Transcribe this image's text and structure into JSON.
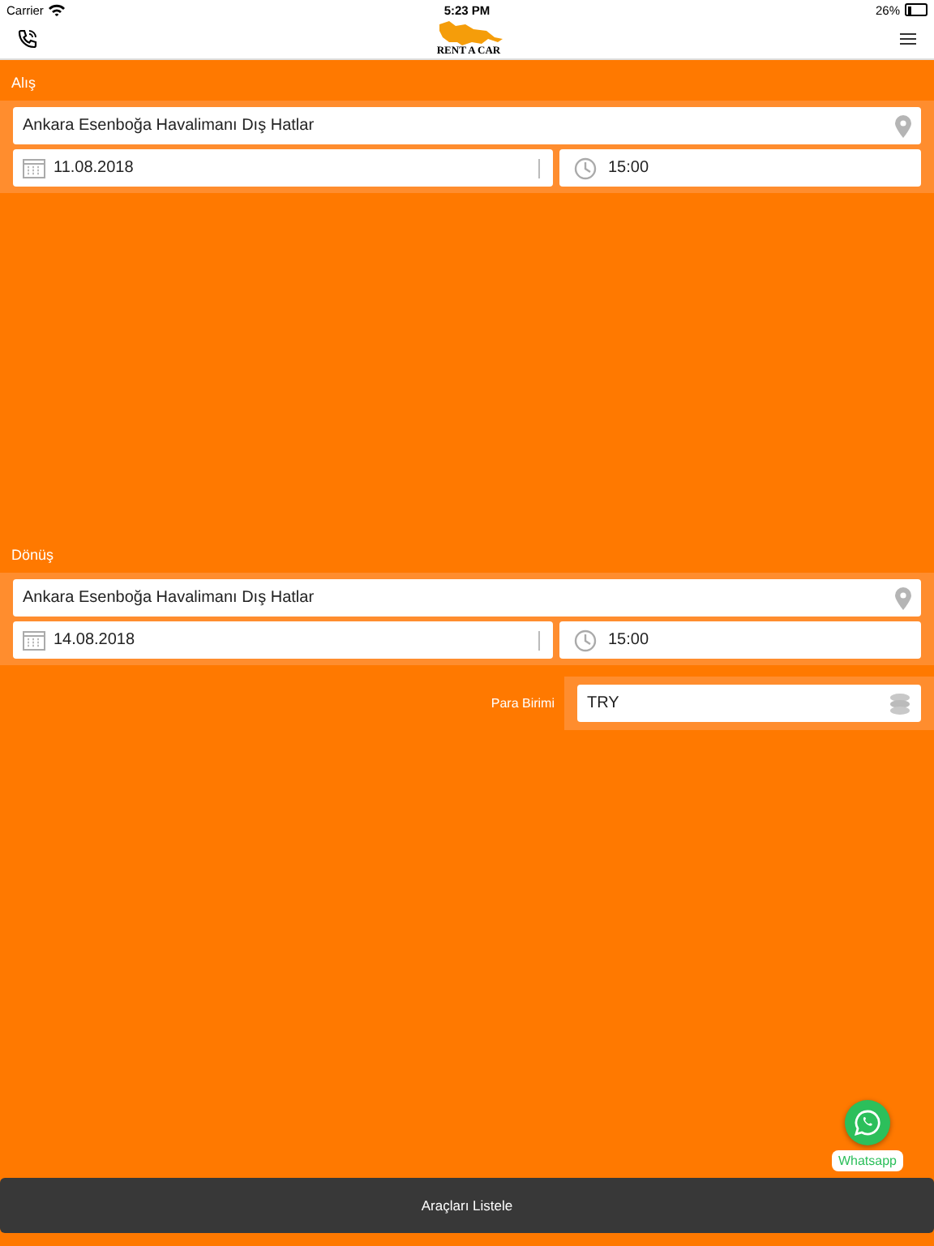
{
  "status_bar": {
    "carrier": "Carrier",
    "time": "5:23 PM",
    "battery": "26%"
  },
  "header": {
    "logo_text": "RENT A CAR"
  },
  "sections": [
    {
      "title": "Alış",
      "location": "Ankara Esenboğa Havalimanı Dış Hatlar",
      "date": "11.08.2018",
      "time": "15:00"
    },
    {
      "title": "Dönüş",
      "location": "Ankara Esenboğa Havalimanı Dış Hatlar",
      "date": "14.08.2018",
      "time": "15:00"
    }
  ],
  "currency": {
    "label": "Para Birimi",
    "value": "TRY"
  },
  "whatsapp": {
    "label": "Whatsapp"
  },
  "list_button": "Araçları Listele"
}
